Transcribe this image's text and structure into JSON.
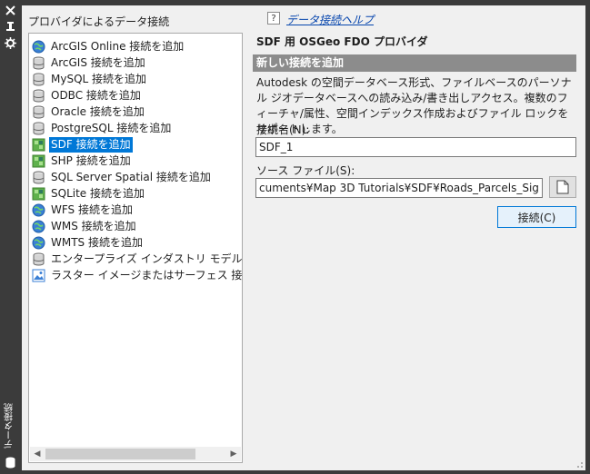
{
  "palette_title": "データ接続",
  "left": {
    "header": "プロバイダによるデータ接続",
    "items": [
      {
        "label": "ArcGIS Online 接続を追加",
        "icon": "globe-icon"
      },
      {
        "label": "ArcGIS 接続を追加",
        "icon": "database-icon"
      },
      {
        "label": "MySQL 接続を追加",
        "icon": "database-icon"
      },
      {
        "label": "ODBC 接続を追加",
        "icon": "database-icon"
      },
      {
        "label": "Oracle 接続を追加",
        "icon": "database-icon"
      },
      {
        "label": "PostgreSQL 接続を追加",
        "icon": "database-icon"
      },
      {
        "label": "SDF 接続を追加",
        "icon": "raster-file-icon",
        "selected": true
      },
      {
        "label": "SHP 接続を追加",
        "icon": "raster-file-icon"
      },
      {
        "label": "SQL Server Spatial 接続を追加",
        "icon": "database-icon"
      },
      {
        "label": "SQLite 接続を追加",
        "icon": "raster-file-icon"
      },
      {
        "label": "WFS 接続を追加",
        "icon": "globe-icon"
      },
      {
        "label": "WMS 接続を追加",
        "icon": "globe-icon"
      },
      {
        "label": "WMTS 接続を追加",
        "icon": "globe-icon"
      },
      {
        "label": "エンタープライズ インダストリ モデル 接続を追加",
        "icon": "database-icon"
      },
      {
        "label": "ラスター イメージまたはサーフェス 接続を追加",
        "icon": "image-icon"
      }
    ]
  },
  "right": {
    "help_icon_text": "?",
    "help_link": "データ接続ヘルプ",
    "provider_title": "SDF 用 OSGeo FDO プロバイダ",
    "section": "新しい接続を追加",
    "description": "Autodesk の空間データベース形式、ファイルベースのパーソナル ジオデータベースへの読み込み/書き出しアクセス。複数のフィーチャ/属性、空間インデックス作成およびファイル ロックをサポートします。",
    "connection_name_label": "接続名(N):",
    "connection_name_value": "SDF_1",
    "source_file_label": "ソース ファイル(S):",
    "source_file_value": "cuments¥Map 3D Tutorials¥SDF¥Roads_Parcels_Signals.SDF",
    "connect_button": "接続(C)"
  },
  "colors": {
    "selection": "#0078d7",
    "section_bar": "#8c8c8c",
    "titlebar": "#3b3b3b",
    "link": "#0645ad"
  }
}
